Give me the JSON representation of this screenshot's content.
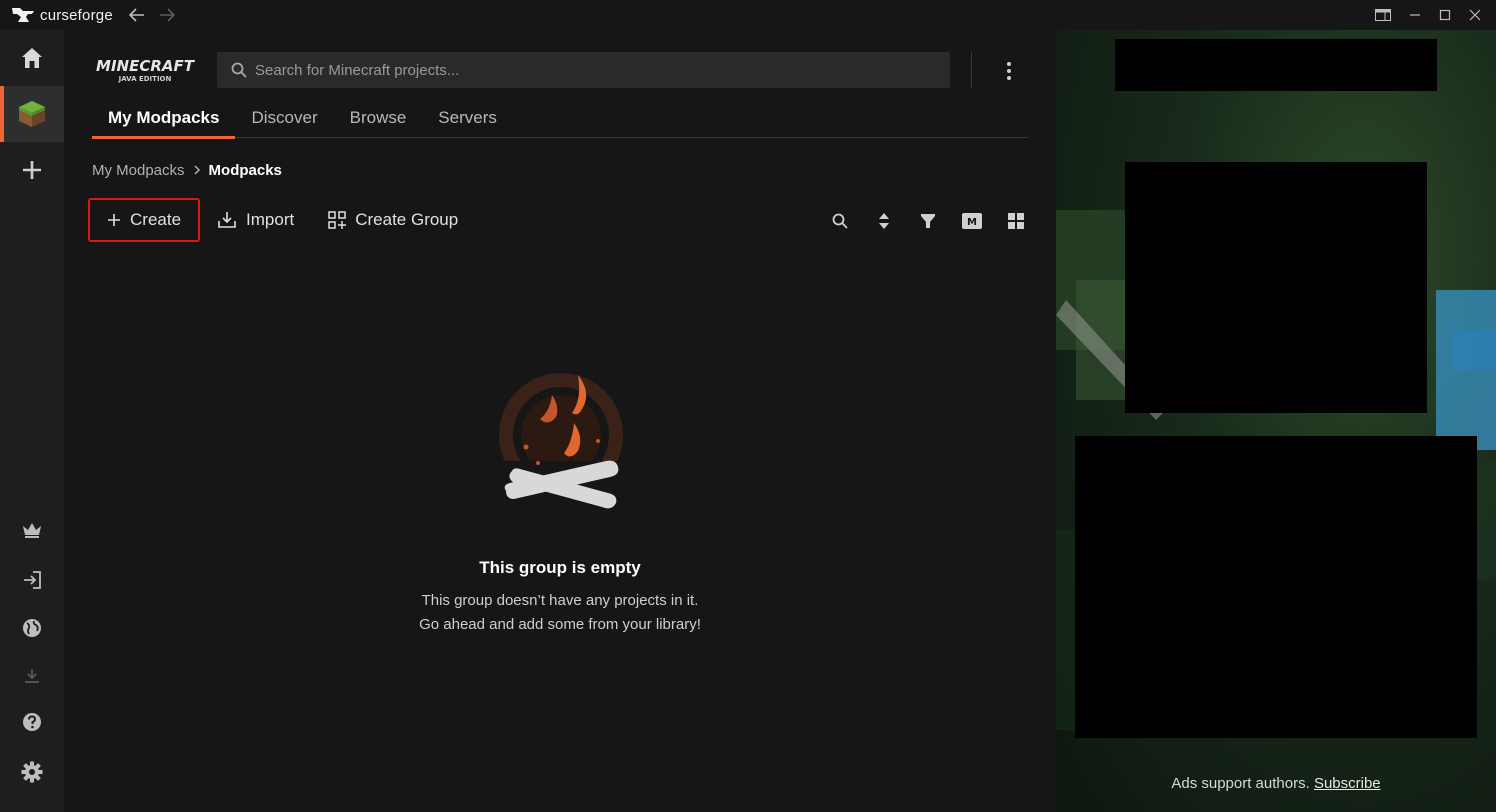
{
  "app": {
    "title": "curseforge"
  },
  "window_controls": {
    "layout_label": "layout-icon",
    "minimize_label": "minimize-icon",
    "maximize_label": "maximize-icon",
    "close_label": "close-icon"
  },
  "sidebar": {
    "items": [
      {
        "name": "home",
        "icon": "home-icon"
      },
      {
        "name": "minecraft",
        "icon": "grass-block-icon"
      },
      {
        "name": "add-game",
        "icon": "plus-icon"
      },
      {
        "name": "premium",
        "icon": "crown-icon"
      },
      {
        "name": "login",
        "icon": "login-icon"
      },
      {
        "name": "web",
        "icon": "globe-icon"
      },
      {
        "name": "downloads",
        "icon": "download-icon"
      },
      {
        "name": "help",
        "icon": "help-icon"
      },
      {
        "name": "settings",
        "icon": "gear-icon"
      }
    ]
  },
  "header": {
    "game_logo_line1": "MINECRAFT",
    "game_logo_line2": "JAVA EDITION",
    "search_placeholder": "Search for Minecraft projects..."
  },
  "tabs": [
    {
      "label": "My Modpacks",
      "active": true
    },
    {
      "label": "Discover",
      "active": false
    },
    {
      "label": "Browse",
      "active": false
    },
    {
      "label": "Servers",
      "active": false
    }
  ],
  "breadcrumb": {
    "parent": "My Modpacks",
    "current": "Modpacks"
  },
  "actions": {
    "create_label": "Create",
    "import_label": "Import",
    "create_group_label": "Create Group",
    "view_mode_badge": "M"
  },
  "empty_state": {
    "title": "This group is empty",
    "line1": "This group doesn’t have any projects in it.",
    "line2": "Go ahead and add some from your library!"
  },
  "ads": {
    "note": "Ads support authors.",
    "subscribe_label": "Subscribe"
  },
  "colors": {
    "accent": "#f16436",
    "highlight_border": "#e0141e"
  }
}
